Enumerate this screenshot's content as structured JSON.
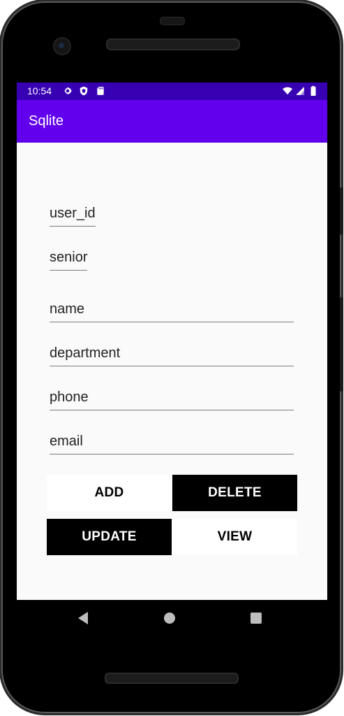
{
  "status_bar": {
    "time": "10:54",
    "icons": [
      "settings-icon",
      "shield-icon",
      "sd-card-icon",
      "wifi-icon",
      "signal-icon",
      "battery-icon"
    ]
  },
  "app_bar": {
    "title": "Sqlite",
    "color": "#6200ee"
  },
  "form": {
    "user_id": "user_id",
    "senior": "senior",
    "name": "name",
    "department": "department",
    "phone": "phone",
    "email": "email"
  },
  "buttons": {
    "add": "ADD",
    "delete": "DELETE",
    "update": "UPDATE",
    "view": "VIEW"
  },
  "nav_bar": [
    "back-icon",
    "home-icon",
    "recents-icon"
  ]
}
